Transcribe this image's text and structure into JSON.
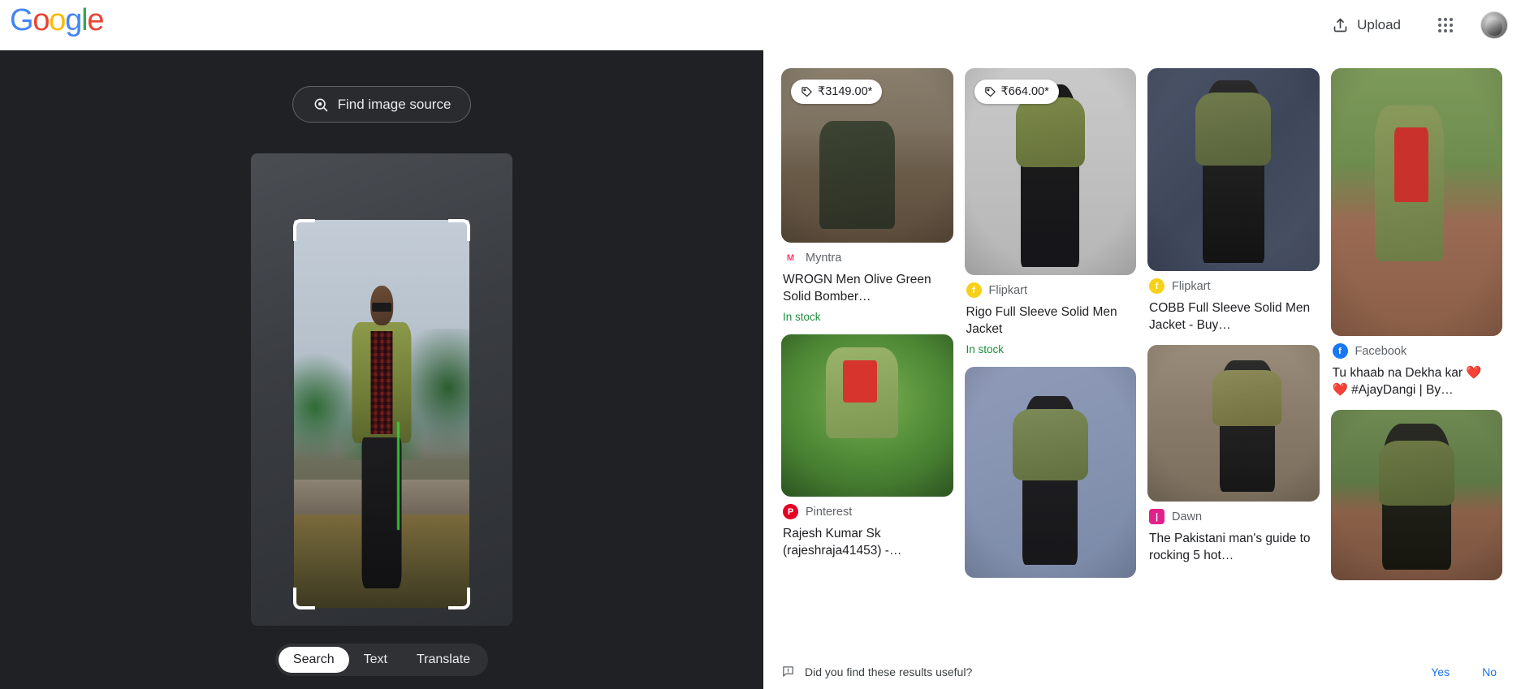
{
  "header": {
    "logo_text": "Google",
    "logo_letters": [
      "G",
      "o",
      "o",
      "g",
      "l",
      "e"
    ],
    "upload_label": "Upload",
    "upload_icon": "upload-icon",
    "apps_icon": "apps-grid-icon",
    "avatar_icon": "account-avatar"
  },
  "left_panel": {
    "find_image_source_label": "Find image source",
    "find_image_source_icon": "lens-search-icon",
    "crop_handles": [
      "top-left",
      "top-right",
      "bottom-left",
      "bottom-right"
    ],
    "mode_tabs": [
      {
        "label": "Search",
        "active": true
      },
      {
        "label": "Text",
        "active": false
      },
      {
        "label": "Translate",
        "active": false
      }
    ]
  },
  "results": {
    "cards": [
      {
        "id": "myntra-wrogn",
        "price": "₹3149.00*",
        "price_icon": "price-tag-icon",
        "source": "Myntra",
        "source_icon": "myntra-logo",
        "source_color": "#ff3f6c",
        "source_bg": "#ffffff",
        "source_glyph": "M",
        "title": "WROGN Men Olive Green Solid Bomber…",
        "stock": "In stock",
        "thumb_class": "a",
        "thumb_height": 215,
        "column": 1
      },
      {
        "id": "pinterest-rajesh",
        "price": "",
        "source": "Pinterest",
        "source_icon": "pinterest-logo",
        "source_color": "#ffffff",
        "source_bg": "#e60023",
        "source_glyph": "P",
        "title": "Rajesh Kumar Sk (rajeshraja41453) -…",
        "stock": "",
        "thumb_class": "e",
        "thumb_height": 200,
        "column": 1
      },
      {
        "id": "flipkart-rigo",
        "price": "₹664.00*",
        "price_icon": "price-tag-icon",
        "source": "Flipkart",
        "source_icon": "flipkart-logo",
        "source_color": "#ffffff",
        "source_bg": "#f7d117",
        "source_glyph": "f",
        "title": "Rigo Full Sleeve Solid Men Jacket",
        "stock": "In stock",
        "thumb_class": "b",
        "thumb_height": 255,
        "column": 2
      },
      {
        "id": "result-football",
        "price": "",
        "source": "",
        "source_icon": "",
        "title": "",
        "stock": "",
        "thumb_class": "f",
        "thumb_height": 260,
        "column": 2
      },
      {
        "id": "flipkart-cobb",
        "price": "",
        "source": "Flipkart",
        "source_icon": "flipkart-logo",
        "source_color": "#ffffff",
        "source_bg": "#f7d117",
        "source_glyph": "f",
        "title": "COBB Full Sleeve Solid Men Jacket - Buy…",
        "stock": "",
        "thumb_class": "c",
        "thumb_height": 250,
        "column": 3
      },
      {
        "id": "dawn-pakistani",
        "price": "",
        "source": "Dawn",
        "source_icon": "dawn-logo",
        "source_color": "#ffffff",
        "source_bg": "#e0218a",
        "source_glyph": "|",
        "title": "The Pakistani man's guide to rocking 5 hot…",
        "stock": "",
        "thumb_class": "g",
        "thumb_height": 193,
        "column": 3
      },
      {
        "id": "facebook-ajaydangi",
        "price": "",
        "source": "Facebook",
        "source_icon": "facebook-logo",
        "source_color": "#ffffff",
        "source_bg": "#1877f2",
        "source_glyph": "f",
        "title": "Tu khaab na Dekha kar ❤️ ❤️ #AjayDangi | By…",
        "stock": "",
        "thumb_class": "d",
        "thumb_height": 330,
        "column": 4
      },
      {
        "id": "result-park-bomber",
        "price": "",
        "source": "",
        "source_icon": "",
        "title": "",
        "stock": "",
        "thumb_class": "h",
        "thumb_height": 210,
        "column": 4
      }
    ]
  },
  "feedback": {
    "icon": "feedback-icon",
    "question": "Did you find these results useful?",
    "yes_label": "Yes",
    "no_label": "No",
    "link_color": "#1a73e8"
  }
}
